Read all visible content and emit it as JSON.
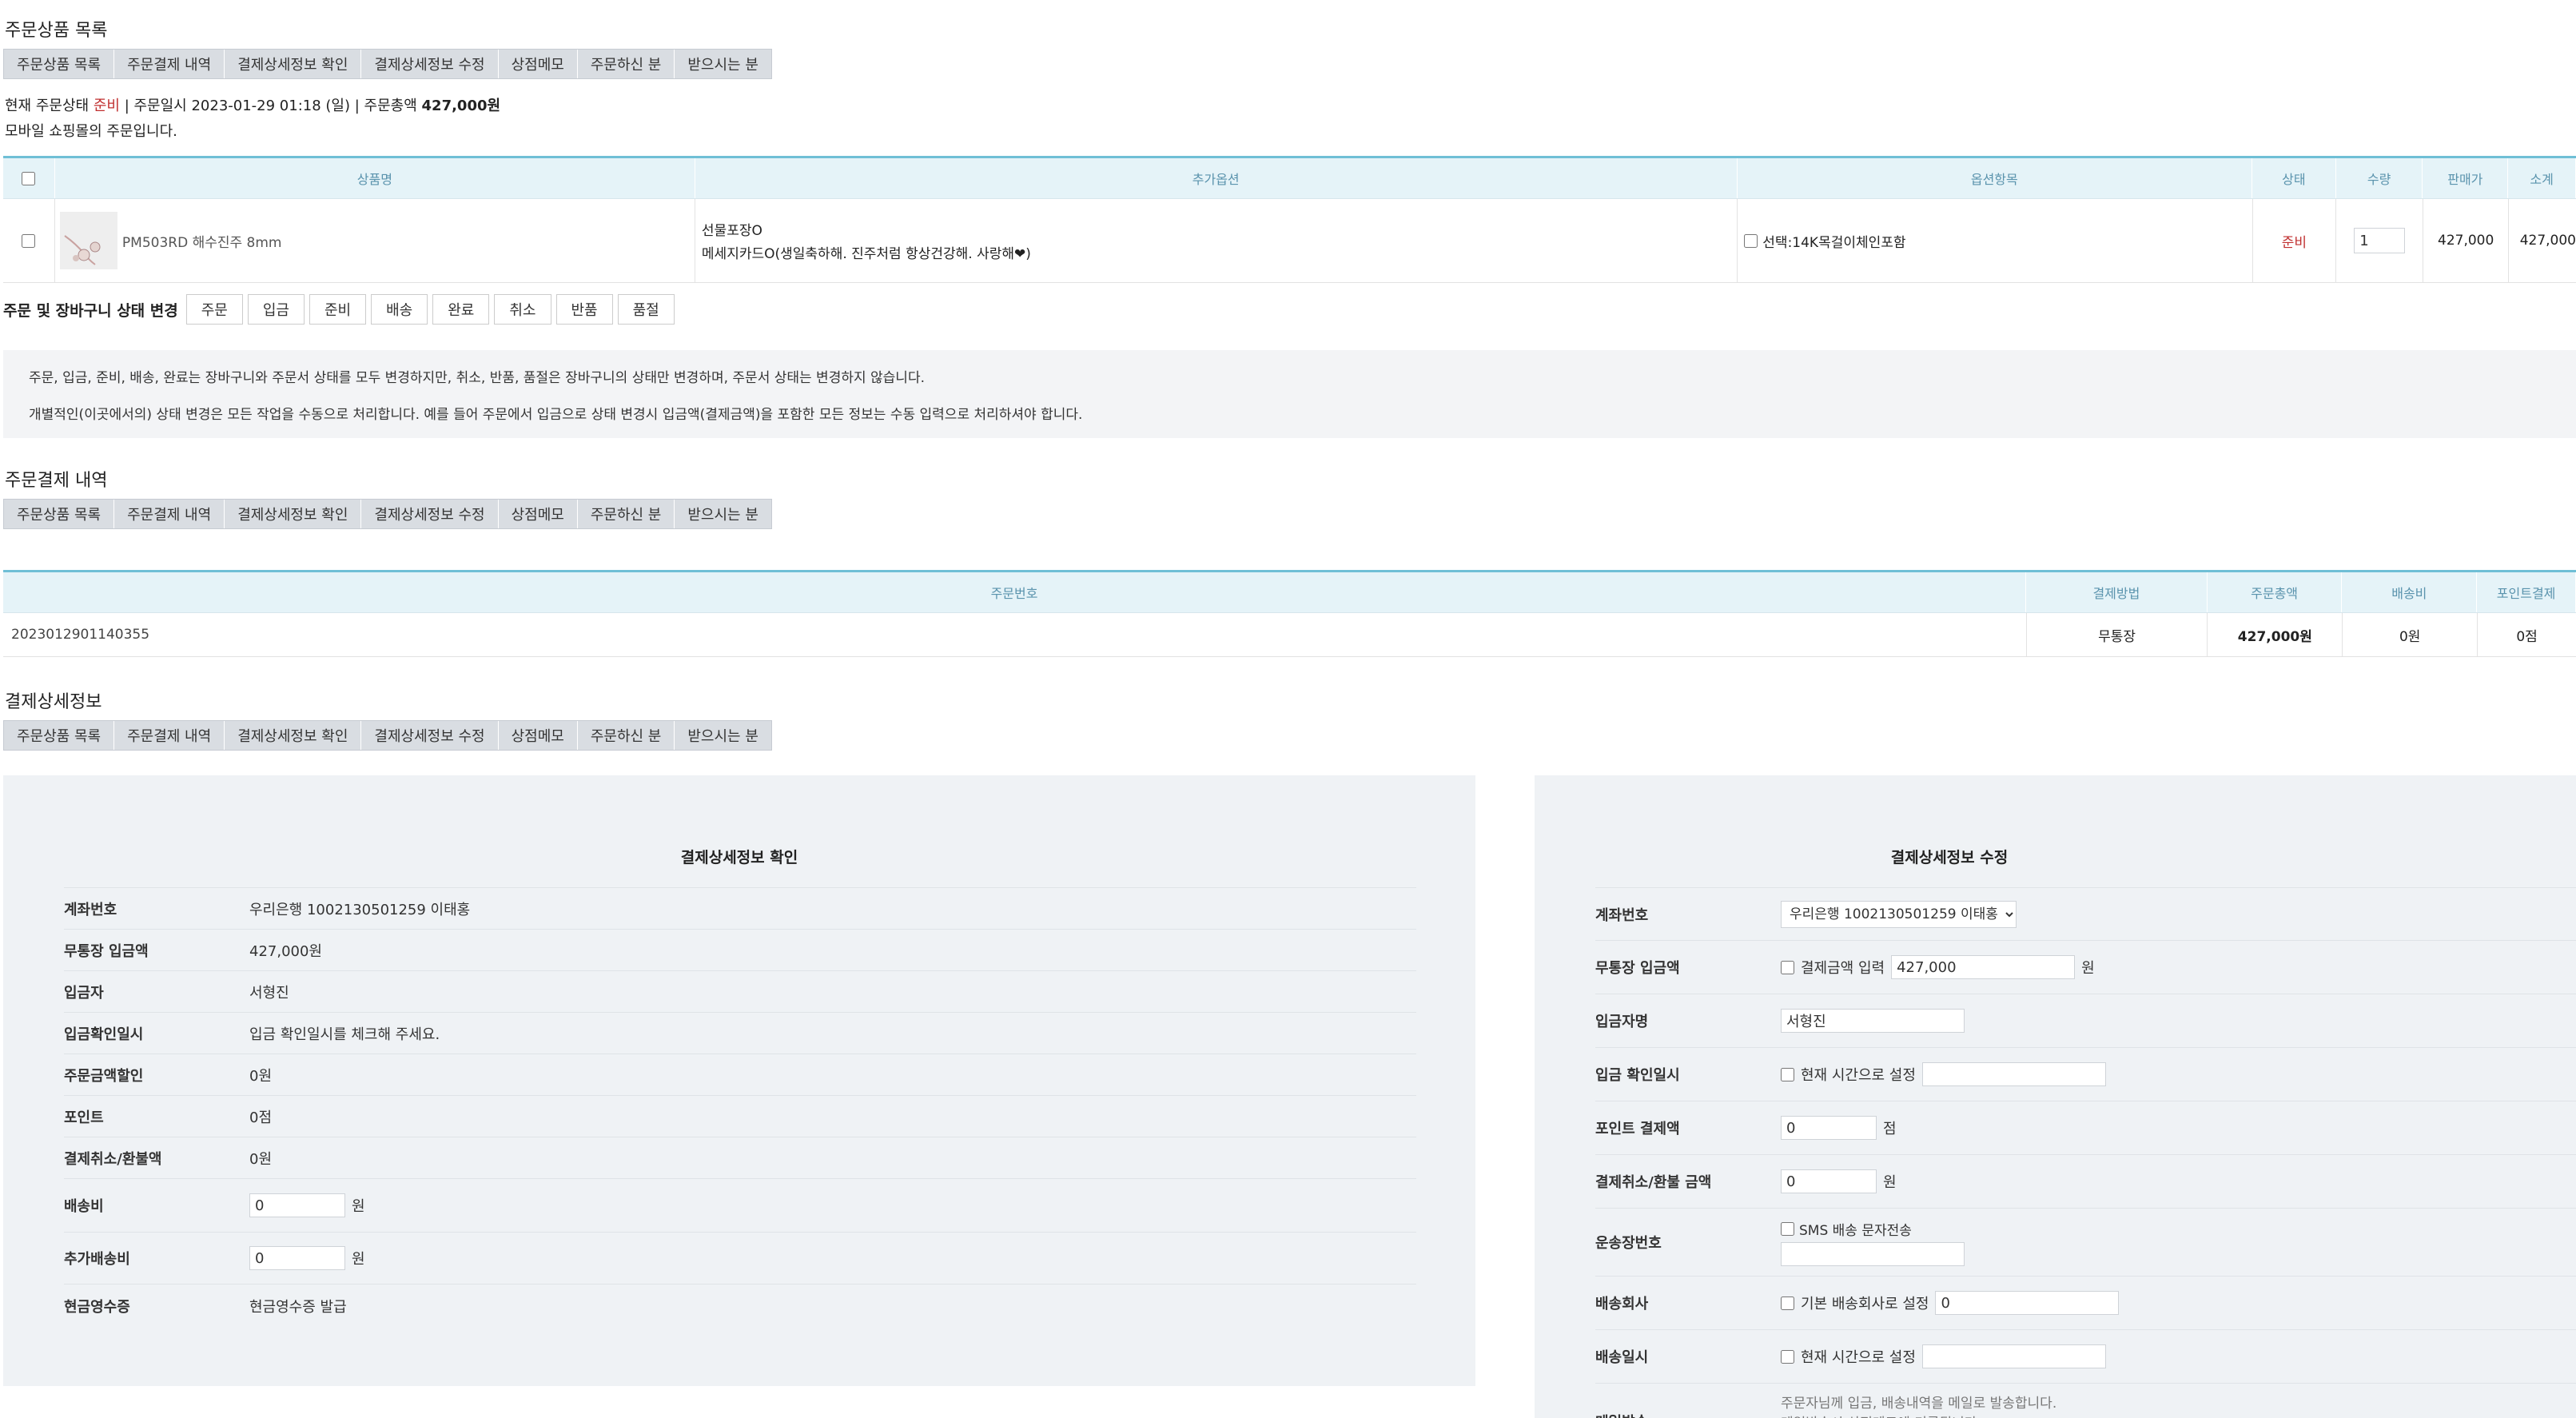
{
  "sections": {
    "order_items_title": "주문상품 목록",
    "payment_title": "주문결제 내역",
    "pay_detail_title": "결제상세정보"
  },
  "anchor_tabs": [
    "주문상품 목록",
    "주문결제 내역",
    "결제상세정보 확인",
    "결제상세정보 수정",
    "상점메모",
    "주문하신 분",
    "받으시는 분"
  ],
  "order_info": {
    "status_label": "현재 주문상태",
    "status_value": "준비",
    "date_label": "주문일시",
    "date_value": "2023-01-29 01:18 (일)",
    "total_label": "주문총액",
    "total_value": "427,000원",
    "mobile_note": "모바일 쇼핑몰의 주문입니다."
  },
  "items_table": {
    "headers": [
      "상품명",
      "추가옵션",
      "옵션항목",
      "상태",
      "수량",
      "판매가",
      "소계"
    ],
    "row": {
      "product_name": "PM503RD 해수진주 8mm",
      "option_line1": "선물포장O",
      "option_line2": "메세지카드O(생일축하해. 진주처럼 항상건강해. 사랑해❤)",
      "option_item": "선택:14K목걸이체인포함",
      "status": "준비",
      "qty": "1",
      "price": "427,000",
      "subtotal": "427,000"
    }
  },
  "status_change": {
    "label": "주문 및 장바구니 상태 변경",
    "buttons": [
      "주문",
      "입금",
      "준비",
      "배송",
      "완료",
      "취소",
      "반품",
      "품절"
    ]
  },
  "notice": {
    "line1": "주문, 입금, 준비, 배송, 완료는 장바구니와 주문서 상태를 모두 변경하지만, 취소, 반품, 품절은 장바구니의 상태만 변경하며, 주문서 상태는 변경하지 않습니다.",
    "line2": "개별적인(이곳에서의) 상태 변경은 모든 작업을 수동으로 처리합니다. 예를 들어 주문에서 입금으로 상태 변경시 입금액(결제금액)을 포함한 모든 정보는 수동 입력으로 처리하셔야 합니다."
  },
  "payment_table": {
    "headers": [
      "주문번호",
      "결제방법",
      "주문총액",
      "배송비",
      "포인트결제"
    ],
    "row": [
      "2023012901140355",
      "무통장",
      "427,000원",
      "0원",
      "0점"
    ]
  },
  "confirm_panel": {
    "title": "결제상세정보 확인",
    "rows": [
      {
        "label": "계좌번호",
        "value": "우리은행 1002130501259 이태홍"
      },
      {
        "label": "무통장 입금액",
        "value": "427,000원"
      },
      {
        "label": "입금자",
        "value": "서형진"
      },
      {
        "label": "입금확인일시",
        "value": "입금 확인일시를 체크해 주세요."
      },
      {
        "label": "주문금액할인",
        "value": "0원"
      },
      {
        "label": "포인트",
        "value": "0점"
      },
      {
        "label": "결제취소/환불액",
        "value": "0원"
      }
    ],
    "shipping_label": "배송비",
    "shipping_value": "0",
    "extra_shipping_label": "추가배송비",
    "extra_shipping_value": "0",
    "won": "원",
    "receipt_label": "현금영수증",
    "receipt_value": "현금영수증 발급"
  },
  "edit_panel": {
    "title": "결제상세정보 수정",
    "account_label": "계좌번호",
    "account_value": "우리은행 1002130501259 이태홍",
    "deposit_label": "무통장 입금액",
    "deposit_check_label": "결제금액 입력",
    "deposit_value": "427,000",
    "won": "원",
    "depositor_label": "입금자명",
    "depositor_value": "서형진",
    "confirm_date_label": "입금 확인일시",
    "now_time_label": "현재 시간으로 설정",
    "point_label": "포인트 결제액",
    "point_value": "0",
    "point_unit": "점",
    "refund_label": "결제취소/환불 금액",
    "refund_value": "0",
    "invoice_label": "운송장번호",
    "sms_label": "SMS 배송 문자전송",
    "courier_label": "배송회사",
    "default_courier_label": "기본 배송회사로 설정",
    "courier_value": "0",
    "ship_date_label": "배송일시",
    "mail_label": "메일발송",
    "mail_note1": "주문자님께 입금, 배송내역을 메일로 발송합니다.",
    "mail_note2": "메일발송시 상점메모에 기록됩니다."
  }
}
